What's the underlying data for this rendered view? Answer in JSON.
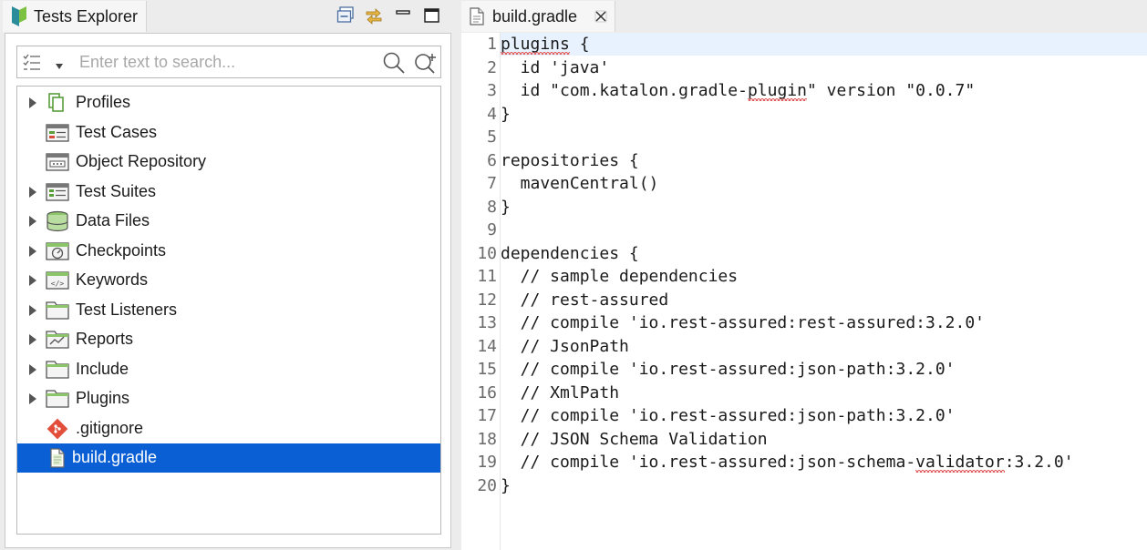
{
  "explorer": {
    "tab_label": "Tests Explorer",
    "search_placeholder": "Enter text to search...",
    "search_value": "",
    "toolbar_icons": [
      "collapse-all-icon",
      "link-with-editor-icon",
      "minimize-icon",
      "maximize-icon"
    ],
    "tree": [
      {
        "label": "Profiles",
        "icon": "profiles-icon",
        "expandable": true,
        "selected": false
      },
      {
        "label": "Test Cases",
        "icon": "test-cases-icon",
        "expandable": false,
        "selected": false
      },
      {
        "label": "Object Repository",
        "icon": "object-repository-icon",
        "expandable": false,
        "selected": false
      },
      {
        "label": "Test Suites",
        "icon": "test-suites-icon",
        "expandable": true,
        "selected": false
      },
      {
        "label": "Data Files",
        "icon": "data-files-icon",
        "expandable": true,
        "selected": false
      },
      {
        "label": "Checkpoints",
        "icon": "checkpoints-icon",
        "expandable": true,
        "selected": false
      },
      {
        "label": "Keywords",
        "icon": "keywords-icon",
        "expandable": true,
        "selected": false
      },
      {
        "label": "Test Listeners",
        "icon": "folder-icon",
        "expandable": true,
        "selected": false
      },
      {
        "label": "Reports",
        "icon": "reports-icon",
        "expandable": true,
        "selected": false
      },
      {
        "label": "Include",
        "icon": "folder-icon",
        "expandable": true,
        "selected": false
      },
      {
        "label": "Plugins",
        "icon": "folder-icon",
        "expandable": true,
        "selected": false
      },
      {
        "label": ".gitignore",
        "icon": "git-icon",
        "expandable": false,
        "selected": false
      },
      {
        "label": "build.gradle",
        "icon": "file-icon",
        "expandable": false,
        "selected": true
      }
    ]
  },
  "editor": {
    "tab_label": "build.gradle",
    "current_line": 1,
    "lines": [
      {
        "num": "1",
        "text": "plugins {"
      },
      {
        "num": "2",
        "text": "  id 'java'"
      },
      {
        "num": "3",
        "text": "  id \"com.katalon.gradle-plugin\" version \"0.0.7\""
      },
      {
        "num": "4",
        "text": "}"
      },
      {
        "num": "5",
        "text": ""
      },
      {
        "num": "6",
        "text": "repositories {"
      },
      {
        "num": "7",
        "text": "  mavenCentral()"
      },
      {
        "num": "8",
        "text": "}"
      },
      {
        "num": "9",
        "text": ""
      },
      {
        "num": "10",
        "text": "dependencies {"
      },
      {
        "num": "11",
        "text": "  // sample dependencies"
      },
      {
        "num": "12",
        "text": "  // rest-assured"
      },
      {
        "num": "13",
        "text": "  // compile 'io.rest-assured:rest-assured:3.2.0'"
      },
      {
        "num": "14",
        "text": "  // JsonPath"
      },
      {
        "num": "15",
        "text": "  // compile 'io.rest-assured:json-path:3.2.0'"
      },
      {
        "num": "16",
        "text": "  // XmlPath"
      },
      {
        "num": "17",
        "text": "  // compile 'io.rest-assured:json-path:3.2.0'"
      },
      {
        "num": "18",
        "text": "  // JSON Schema Validation"
      },
      {
        "num": "19",
        "text": "  // compile 'io.rest-assured:json-schema-validator:3.2.0'"
      },
      {
        "num": "20",
        "text": "}"
      }
    ],
    "spellcheck_words": [
      "plugins",
      "plugin",
      "validator"
    ]
  },
  "colors": {
    "selection": "#0a5fd4",
    "katalon_green": "#5a9e3a",
    "current_line": "#e8f2fe"
  }
}
